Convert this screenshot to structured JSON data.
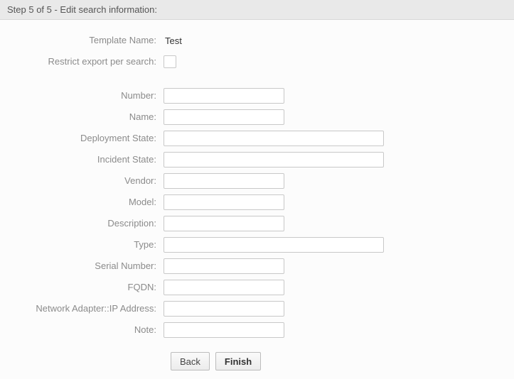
{
  "header": {
    "title": "Step 5 of 5 - Edit search information:"
  },
  "info": {
    "template_name_label": "Template Name:",
    "template_name_value": "Test",
    "restrict_label": "Restrict export per search:",
    "restrict_checked": false
  },
  "fields": {
    "number_label": "Number:",
    "number_value": "",
    "name_label": "Name:",
    "name_value": "",
    "deployment_state_label": "Deployment State:",
    "deployment_state_value": "",
    "incident_state_label": "Incident State:",
    "incident_state_value": "",
    "vendor_label": "Vendor:",
    "vendor_value": "",
    "model_label": "Model:",
    "model_value": "",
    "description_label": "Description:",
    "description_value": "",
    "type_label": "Type:",
    "type_value": "",
    "serial_number_label": "Serial Number:",
    "serial_number_value": "",
    "fqdn_label": "FQDN:",
    "fqdn_value": "",
    "ip_label": "Network Adapter::IP Address:",
    "ip_value": "",
    "note_label": "Note:",
    "note_value": ""
  },
  "buttons": {
    "back": "Back",
    "finish": "Finish"
  }
}
